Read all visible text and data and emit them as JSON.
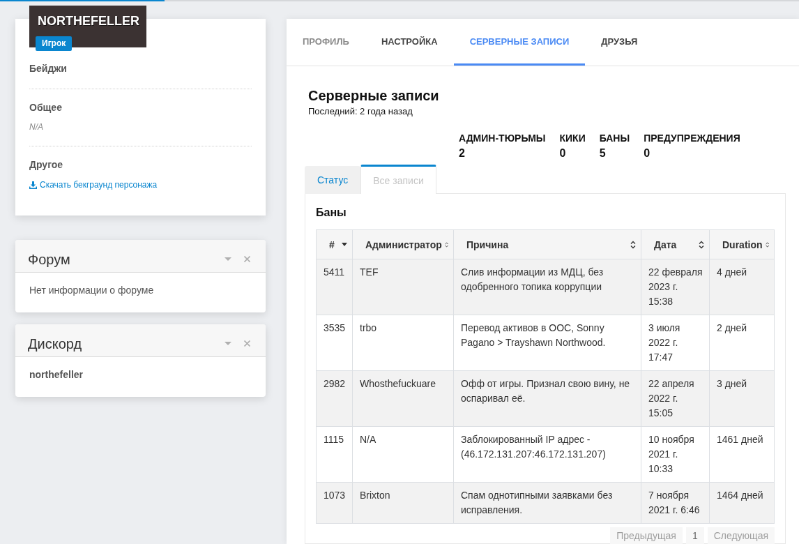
{
  "page_loader": {
    "level": 0.206
  },
  "profile": {
    "name": "NORTHEFELLER",
    "badge": "Игрок",
    "sections": [
      {
        "title": "Бейджи"
      },
      {
        "title": "Общее",
        "value": "N/A"
      },
      {
        "title": "Другое",
        "link": "Скачать бекграунд персонажа"
      }
    ]
  },
  "widgets": [
    {
      "title": "Форум",
      "kind": "note",
      "text": "Нет информации о форуме"
    },
    {
      "title": "Дискорд",
      "kind": "username",
      "text": "northefeller"
    }
  ],
  "tabs": [
    {
      "label": "ПРОФИЛЬ",
      "selected": false,
      "disabled": true
    },
    {
      "label": "НАСТРОЙКА",
      "selected": false,
      "disabled": false
    },
    {
      "label": "СЕРВЕРНЫЕ ЗАПИСИ",
      "selected": true,
      "disabled": false
    },
    {
      "label": "ДРУЗЬЯ",
      "selected": false,
      "disabled": false
    }
  ],
  "records": {
    "title": "Серверные записи",
    "subtitle": "Последний: 2 года назад",
    "stats": [
      {
        "label": "АДМИН-ТЮРЬМЫ",
        "value": "2"
      },
      {
        "label": "КИКИ",
        "value": "0"
      },
      {
        "label": "БАНЫ",
        "value": "5"
      },
      {
        "label": "ПРЕДУПРЕЖДЕНИЯ",
        "value": "0"
      }
    ],
    "subtabs": [
      {
        "label": "Статус",
        "selected": false
      },
      {
        "label": "Все записи",
        "selected": true
      }
    ],
    "section_title": "Баны",
    "table": {
      "columns": [
        {
          "label": "#",
          "sorted": true
        },
        {
          "label": "Администратор",
          "sorted": false
        },
        {
          "label": "Причина",
          "sorted": false
        },
        {
          "label": "Дата",
          "sorted": false
        },
        {
          "label": "Duration",
          "sorted": false
        }
      ],
      "rows": [
        [
          "5411",
          "TEF",
          "Слив информации из МДЦ, без одобренного топика коррупции",
          "22 февраля 2023 г. 15:38",
          "4 дней"
        ],
        [
          "3535",
          "trbo",
          "Перевод активов в OOC, Sonny Pagano > Trayshawn Northwood.",
          "3 июля 2022 г. 17:47",
          "2 дней"
        ],
        [
          "2982",
          "Whosthefuckuare",
          "Офф от игры. Признал свою вину, не оспаривал её.",
          "22 апреля 2022 г. 15:05",
          "3 дней"
        ],
        [
          "1115",
          "N/A",
          "Заблокированный IP адрес - (46.172.131.207:46.172.131.207)",
          "10 ноября 2021 г. 10:33",
          "1461 дней"
        ],
        [
          "1073",
          "Brixton",
          "Спам однотипными заявками без исправления.",
          "7 ноября 2021 г. 6:46",
          "1464 дней"
        ]
      ]
    },
    "pagination": [
      {
        "label": "Предыдущая",
        "disabled": true
      },
      {
        "label": "1",
        "disabled": false
      },
      {
        "label": "Следующая",
        "disabled": true
      }
    ]
  }
}
